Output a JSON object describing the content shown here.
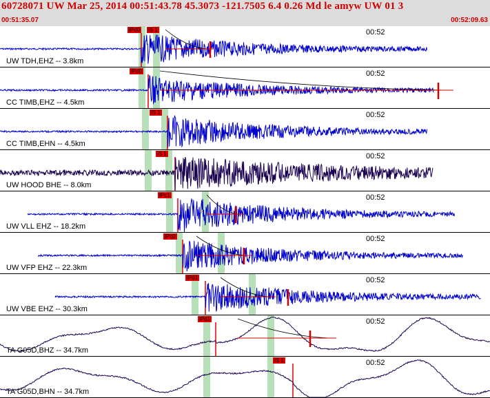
{
  "header": {
    "title": "60728071 UW Mar 25, 2014 00:51:43.78   45.3073 -121.7505  6.4 0.26 Md le amyw UW 01   3",
    "time_start": "00:51:35.07",
    "time_end": "00:52:09.63"
  },
  "colors": {
    "header_bg": "#dcdcdc",
    "header_text": "#d00000",
    "trace_blue": "#0000cc",
    "trace_dark": "#1a0050",
    "pick_red": "#e00000",
    "window_green": "#b8e0b8",
    "overlay_red": "#d00000"
  },
  "minute_label": "00:52",
  "traces": [
    {
      "station": "UW TDH,EHZ -- 3.8km",
      "color": "blue",
      "picks": [
        "iPd0",
        "iS 1"
      ]
    },
    {
      "station": "CC TIMB,EHZ -- 4.5km",
      "color": "blue",
      "picks": [
        "iPd0"
      ]
    },
    {
      "station": "CC TIMB,EHN -- 4.5km",
      "color": "blue",
      "picks": [
        "iS 1"
      ]
    },
    {
      "station": "UW HOOD BHE -- 8.0km",
      "color": "dark",
      "picks": [
        "iS 1"
      ]
    },
    {
      "station": "UW VLL EHZ -- 18.2km",
      "color": "blue",
      "picks": [
        "iPc1"
      ]
    },
    {
      "station": "UW VFP EHZ -- 22.3km",
      "color": "blue",
      "picks": [
        "iPc0"
      ]
    },
    {
      "station": "UW VBE EHZ -- 30.3km",
      "color": "blue",
      "picks": [
        "iPd1"
      ]
    },
    {
      "station": "TA G05D,BHZ -- 34.7km",
      "color": "dark",
      "picks": [
        "iPd1"
      ]
    },
    {
      "station": "TA G05D,BHN -- 34.7km",
      "color": "dark",
      "picks": [
        "iS 1"
      ]
    }
  ]
}
